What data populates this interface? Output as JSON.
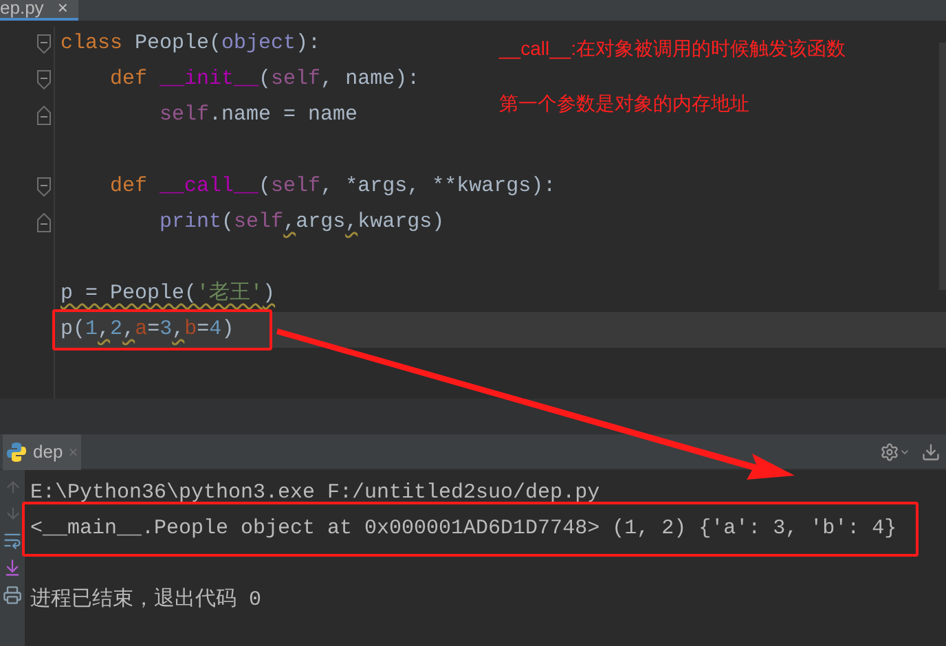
{
  "editor_tab": {
    "label": "ep.py",
    "close": "×",
    "selected": true
  },
  "code_lines": [
    {
      "kind": "code",
      "tokens": [
        {
          "t": "class ",
          "kind": "keyword",
          "warning": false
        },
        {
          "t": "People(",
          "kind": "plain",
          "warning": false
        },
        {
          "t": "object",
          "kind": "builtin",
          "warning": false
        },
        {
          "t": "):",
          "kind": "plain",
          "warning": false
        }
      ],
      "children": [
        {
          "kind": "code",
          "tokens": [
            {
              "t": "def ",
              "kind": "keyword",
              "warning": false
            },
            {
              "t": "__init__",
              "kind": "magic",
              "warning": false
            },
            {
              "t": "(",
              "kind": "plain",
              "warning": false
            },
            {
              "t": "self",
              "kind": "self",
              "warning": false
            },
            {
              "t": ", name):",
              "kind": "plain",
              "warning": false
            }
          ],
          "children": [
            {
              "kind": "code",
              "tokens": [
                {
                  "t": "self",
                  "kind": "self",
                  "warning": false
                },
                {
                  "t": ".name = name",
                  "kind": "plain",
                  "warning": false
                }
              ]
            }
          ]
        },
        {
          "kind": "blank"
        },
        {
          "kind": "code",
          "tokens": [
            {
              "t": "def ",
              "kind": "keyword",
              "warning": false
            },
            {
              "t": "__call__",
              "kind": "magic",
              "warning": false
            },
            {
              "t": "(",
              "kind": "plain",
              "warning": false
            },
            {
              "t": "self",
              "kind": "self",
              "warning": false
            },
            {
              "t": ", *args, **kwargs):",
              "kind": "plain",
              "warning": false
            }
          ],
          "children": [
            {
              "kind": "code",
              "tokens": [
                {
                  "t": "print",
                  "kind": "builtin",
                  "warning": false
                },
                {
                  "t": "(",
                  "kind": "plain",
                  "warning": false
                },
                {
                  "t": "self",
                  "kind": "self",
                  "warning": false
                },
                {
                  "t": ",",
                  "kind": "plain",
                  "warning": true
                },
                {
                  "t": "args",
                  "kind": "plain",
                  "warning": false
                },
                {
                  "t": ",",
                  "kind": "plain",
                  "warning": true
                },
                {
                  "t": "kwargs)",
                  "kind": "plain",
                  "warning": false
                }
              ]
            }
          ]
        }
      ]
    },
    {
      "kind": "blank"
    },
    {
      "kind": "code",
      "tokens": [
        {
          "t": "p = People(",
          "kind": "plain",
          "warning": true
        },
        {
          "t": "'老王'",
          "kind": "string",
          "warning": true
        },
        {
          "t": ")",
          "kind": "plain",
          "warning": true
        }
      ]
    },
    {
      "kind": "code",
      "current": true,
      "boxed": true,
      "tokens": [
        {
          "t": "p(",
          "kind": "plain",
          "warning": false
        },
        {
          "t": "1",
          "kind": "number",
          "warning": false
        },
        {
          "t": ",",
          "kind": "plain",
          "warning": true
        },
        {
          "t": "2",
          "kind": "number",
          "warning": false
        },
        {
          "t": ",",
          "kind": "plain",
          "warning": true
        },
        {
          "t": "a",
          "kind": "param",
          "warning": false
        },
        {
          "t": "=",
          "kind": "plain",
          "warning": false
        },
        {
          "t": "3",
          "kind": "number",
          "warning": false
        },
        {
          "t": ",",
          "kind": "plain",
          "warning": true
        },
        {
          "t": "b",
          "kind": "param",
          "warning": false
        },
        {
          "t": "=",
          "kind": "plain",
          "warning": false
        },
        {
          "t": "4",
          "kind": "number",
          "warning": false
        },
        {
          "t": ")",
          "kind": "plain",
          "warning": false
        }
      ]
    }
  ],
  "annotations": [
    "__call__:在对象被调用的时候触发该函数",
    "第一个参数是对象的内存地址"
  ],
  "run_tab": {
    "label": "dep",
    "close": "×",
    "selected": true
  },
  "console_lines": [
    {
      "kind": "text",
      "text": "E:\\Python36\\python3.exe F:/untitled2suo/dep.py"
    },
    {
      "kind": "text",
      "text": "<__main__.People object at 0x000001AD6D1D7748> (1, 2) {'a': 3, 'b': 4}",
      "boxed": true
    },
    {
      "kind": "blank"
    },
    {
      "kind": "text",
      "text": "进程已结束，退出代码 0"
    }
  ]
}
